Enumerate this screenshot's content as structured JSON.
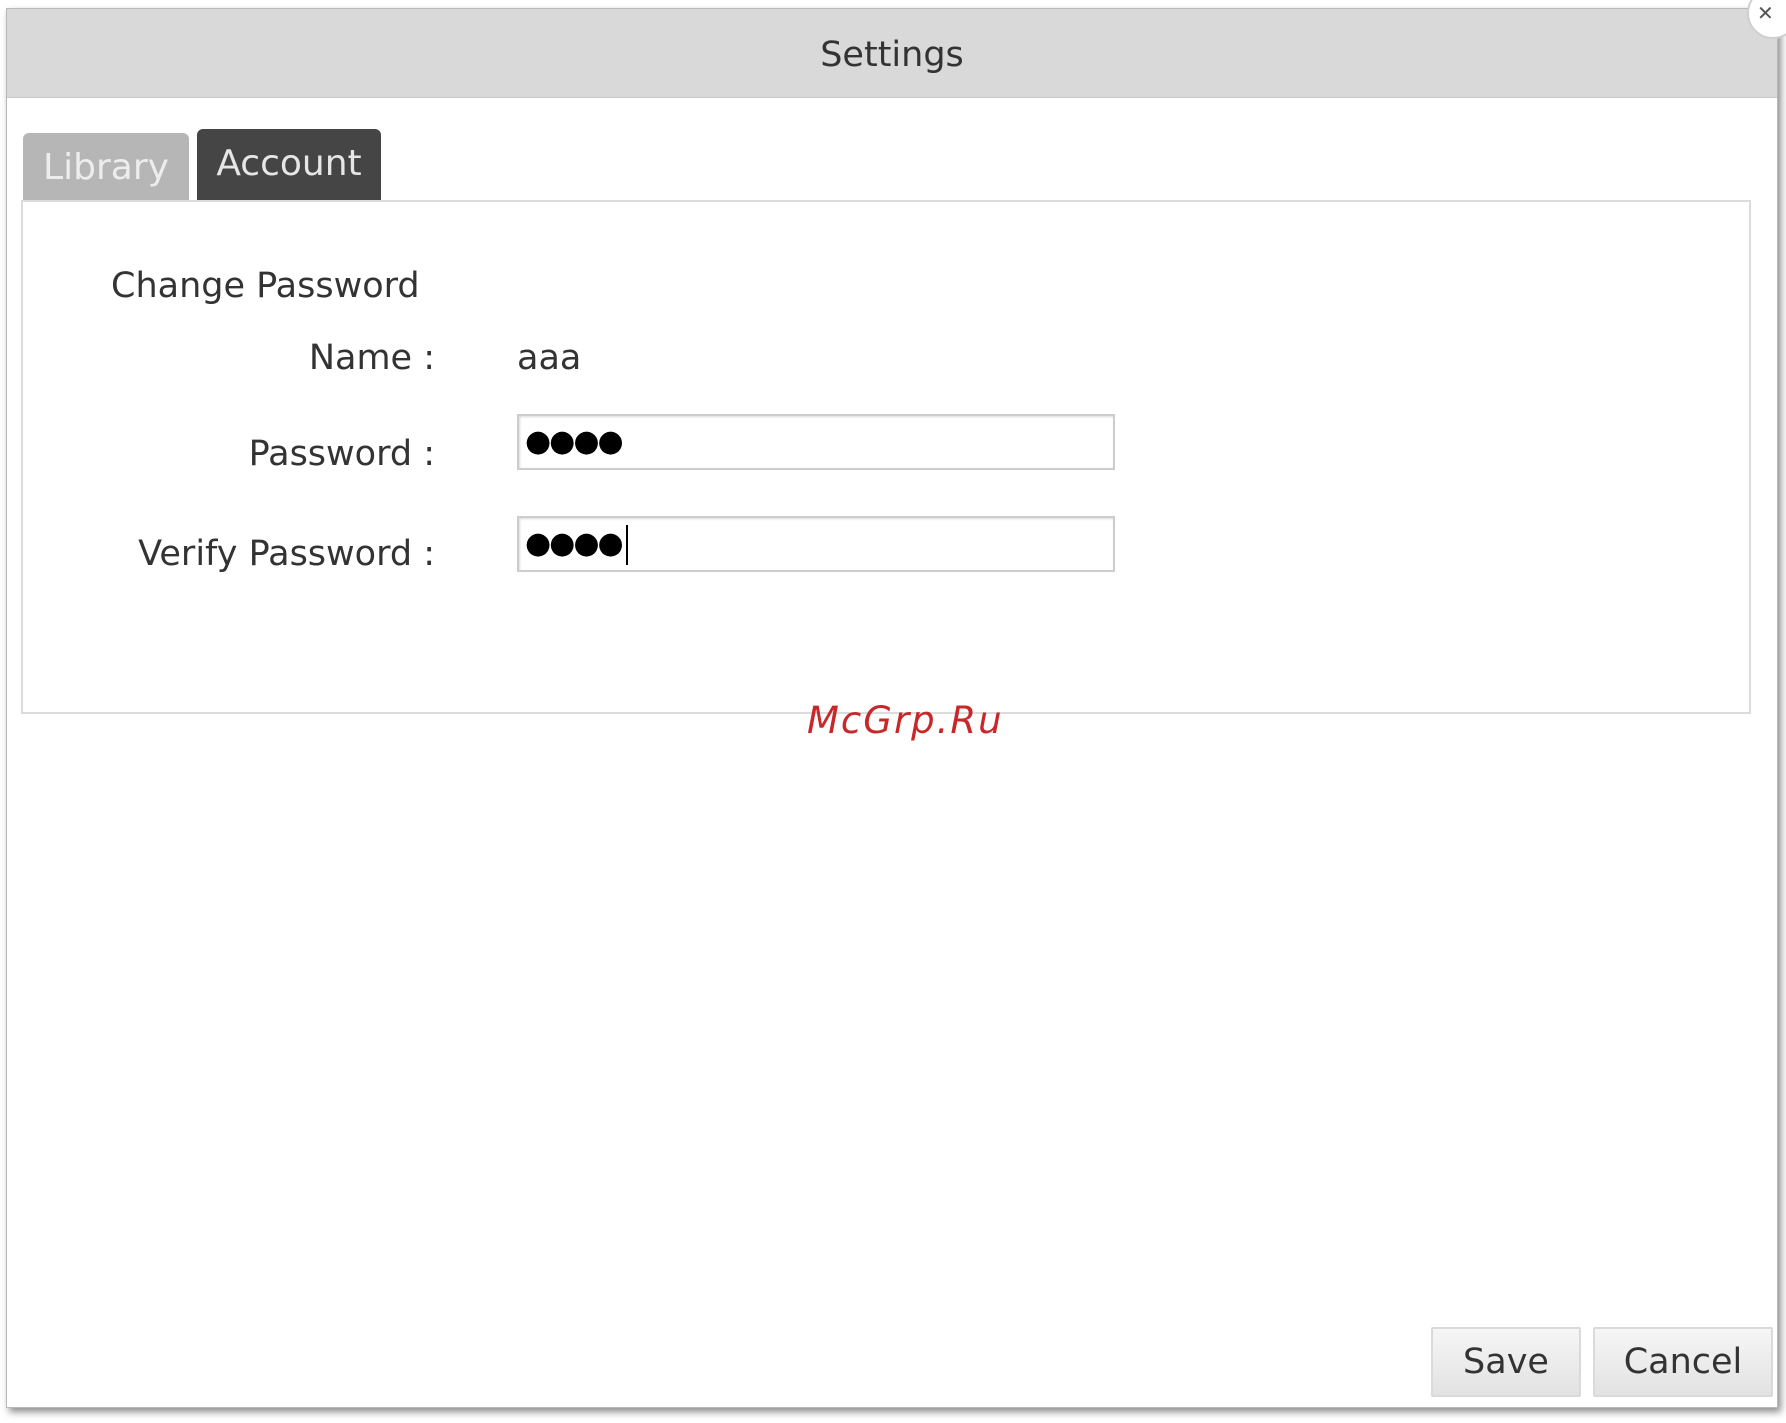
{
  "dialog": {
    "title": "Settings"
  },
  "tabs": [
    {
      "label": "Library",
      "active": false
    },
    {
      "label": "Account",
      "active": true
    }
  ],
  "account": {
    "section_title": "Change Password",
    "name_label": "Name :",
    "name_value": "aaa",
    "password_label": "Password :",
    "password_mask": "●●●●",
    "verify_label": "Verify Password :",
    "verify_mask": "●●●●"
  },
  "watermark": "McGrp.Ru",
  "buttons": {
    "save": "Save",
    "cancel": "Cancel"
  },
  "colors": {
    "titlebar": "#d9d9d9",
    "tab_active": "#454545",
    "tab_inactive": "#b6b6b6",
    "watermark": "#c8282a"
  }
}
